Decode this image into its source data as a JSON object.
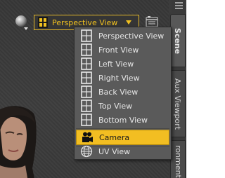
{
  "toolbar": {
    "sphere_icon": "sphere-icon",
    "current_view": "Perspective View",
    "layout_icon": "layout-icon"
  },
  "menu": {
    "items": [
      {
        "label": "Perspective View",
        "icon": "frame-icon"
      },
      {
        "label": "Front View",
        "icon": "frame-icon"
      },
      {
        "label": "Left View",
        "icon": "frame-icon"
      },
      {
        "label": "Right View",
        "icon": "frame-icon"
      },
      {
        "label": "Back View",
        "icon": "frame-icon"
      },
      {
        "label": "Top View",
        "icon": "frame-icon"
      },
      {
        "label": "Bottom View",
        "icon": "frame-icon"
      },
      {
        "label": "Camera",
        "icon": "camera-icon",
        "selected": true
      },
      {
        "label": "UV View",
        "icon": "globe-icon"
      }
    ]
  },
  "side_tabs": [
    {
      "label": "Scene",
      "active": true
    },
    {
      "label": "Aux Viewport"
    },
    {
      "label": "ronment"
    }
  ],
  "colors": {
    "accent": "#f2be22",
    "menu_bg": "#5a5a5a",
    "dropdown_text": "#f0c020"
  }
}
